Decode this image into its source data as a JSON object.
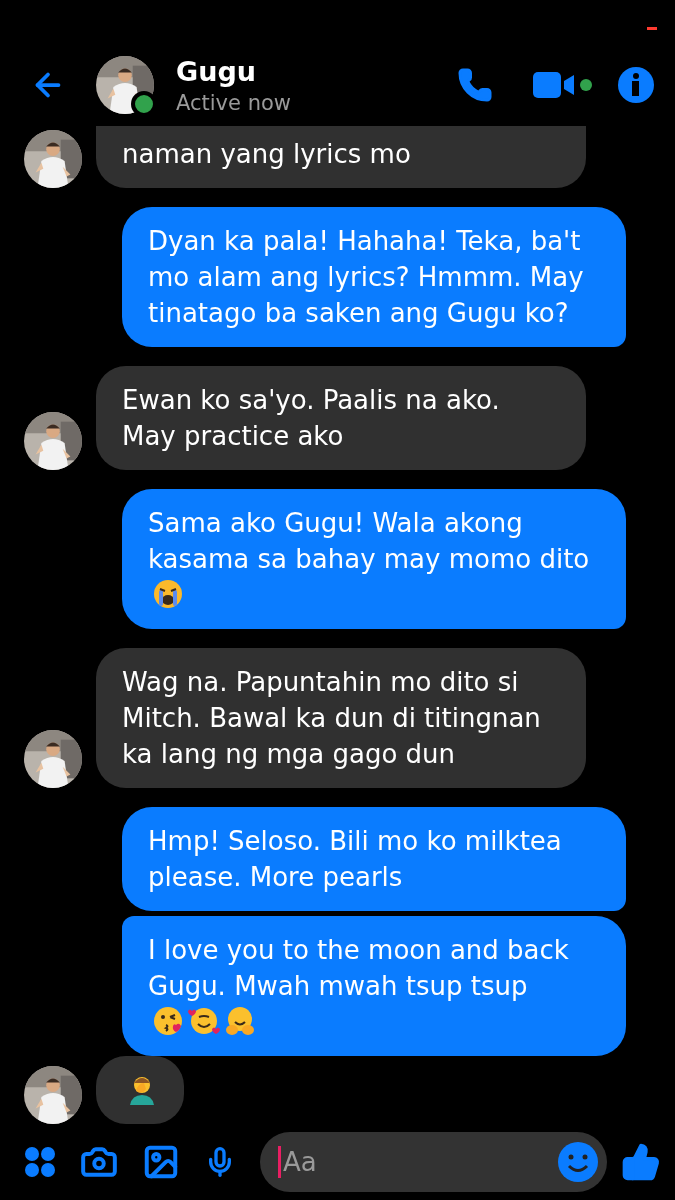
{
  "header": {
    "name": "Gugu",
    "status": "Active now",
    "online": true
  },
  "messages": [
    {
      "sent": false,
      "kind": "plain",
      "text": "naman yang lyrics mo",
      "cut": true,
      "avatar": true
    },
    {
      "sent": true,
      "kind": "plain",
      "text": "Dyan ka pala! Hahaha! Teka, ba't mo alam ang lyrics? Hmmm. May tinatago ba saken ang Gugu ko?"
    },
    {
      "sent": false,
      "kind": "plain",
      "text": "Ewan ko sa'yo. Paalis na ako. May practice ako",
      "avatar": true
    },
    {
      "sent": true,
      "kind": "crying",
      "text": "Sama ako Gugu! Wala akong kasama sa bahay may momo dito"
    },
    {
      "sent": false,
      "kind": "plain",
      "text": "Wag na. Papuntahin mo dito si Mitch. Bawal ka dun di titingnan ka lang ng mga gago dun",
      "avatar": true
    },
    {
      "sent": true,
      "kind": "plain",
      "text": "Hmp! Seloso. Bili mo ko milktea please. More pearls"
    },
    {
      "sent": true,
      "kind": "kisses",
      "text": "I love you to the moon and back Gugu. Mwah mwah tsup tsup",
      "grouped": true
    },
    {
      "sent": false,
      "kind": "facepalm",
      "avatar": true
    }
  ],
  "composer": {
    "placeholder": "Aa"
  }
}
